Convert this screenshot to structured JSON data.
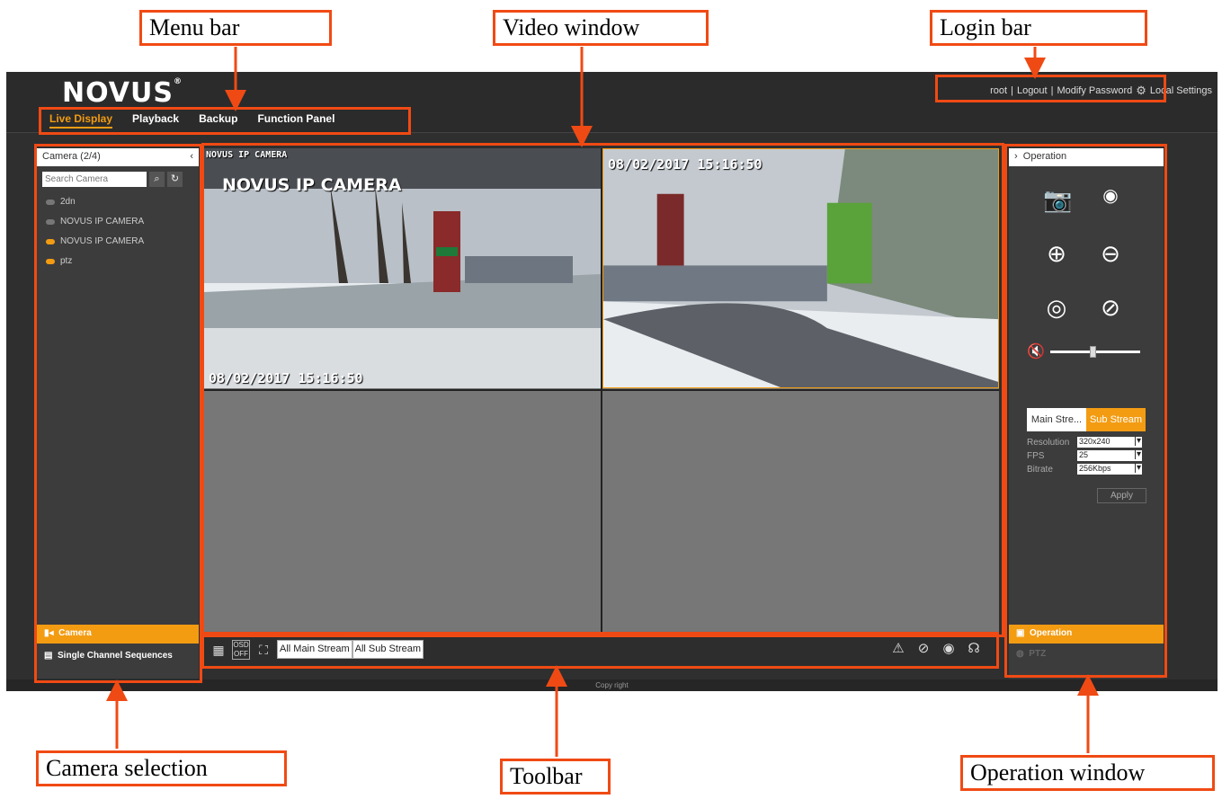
{
  "annotations": {
    "menu_bar": "Menu bar",
    "video_window": "Video window",
    "login_bar": "Login bar",
    "camera_selection": "Camera selection",
    "toolbar": "Toolbar",
    "operation_window": "Operation window"
  },
  "brand": {
    "logo": "NOVUS",
    "accent_color": "#f39c12",
    "annotation_color": "#f04a14"
  },
  "menu": {
    "items": [
      {
        "label": "Live Display",
        "active": true
      },
      {
        "label": "Playback"
      },
      {
        "label": "Backup"
      },
      {
        "label": "Function Panel"
      }
    ]
  },
  "login": {
    "user": "root",
    "logout": "Logout",
    "modify_password": "Modify Password",
    "local_settings": "Local Settings",
    "separator": "|",
    "gear_icon": "gear-icon"
  },
  "camera_panel": {
    "title": "Camera (2/4)",
    "search_placeholder": "Search Camera",
    "cameras": [
      {
        "name": "2dn",
        "online": false
      },
      {
        "name": "NOVUS IP CAMERA",
        "online": false
      },
      {
        "name": "NOVUS IP CAMERA",
        "online": true
      },
      {
        "name": "ptz",
        "online": true
      }
    ],
    "tab_camera": "Camera",
    "tab_sequences": "Single Channel Sequences"
  },
  "video": {
    "cell1_title": "NOVUS IP CAMERA",
    "cell1_small_title": "NOVUS IP CAMERA",
    "cell1_timestamp": "08/02/2017 15:16:50",
    "cell2_timestamp": "08/02/2017 15:16:50"
  },
  "toolbar": {
    "osd_on": "OSD",
    "osd_off": "OFF",
    "all_main_stream": "All Main Stream",
    "all_sub_stream": "All Sub Stream"
  },
  "operation_panel": {
    "title": "Operation",
    "stream_main": "Main Stre...",
    "stream_sub": "Sub Stream",
    "resolution_label": "Resolution",
    "resolution_value": "320x240",
    "fps_label": "FPS",
    "fps_value": "25",
    "bitrate_label": "Bitrate",
    "bitrate_value": "256Kbps",
    "apply": "Apply",
    "tab_operation": "Operation",
    "tab_ptz": "PTZ",
    "volume_level": 0.45
  },
  "footer": {
    "text": "Copy right"
  }
}
